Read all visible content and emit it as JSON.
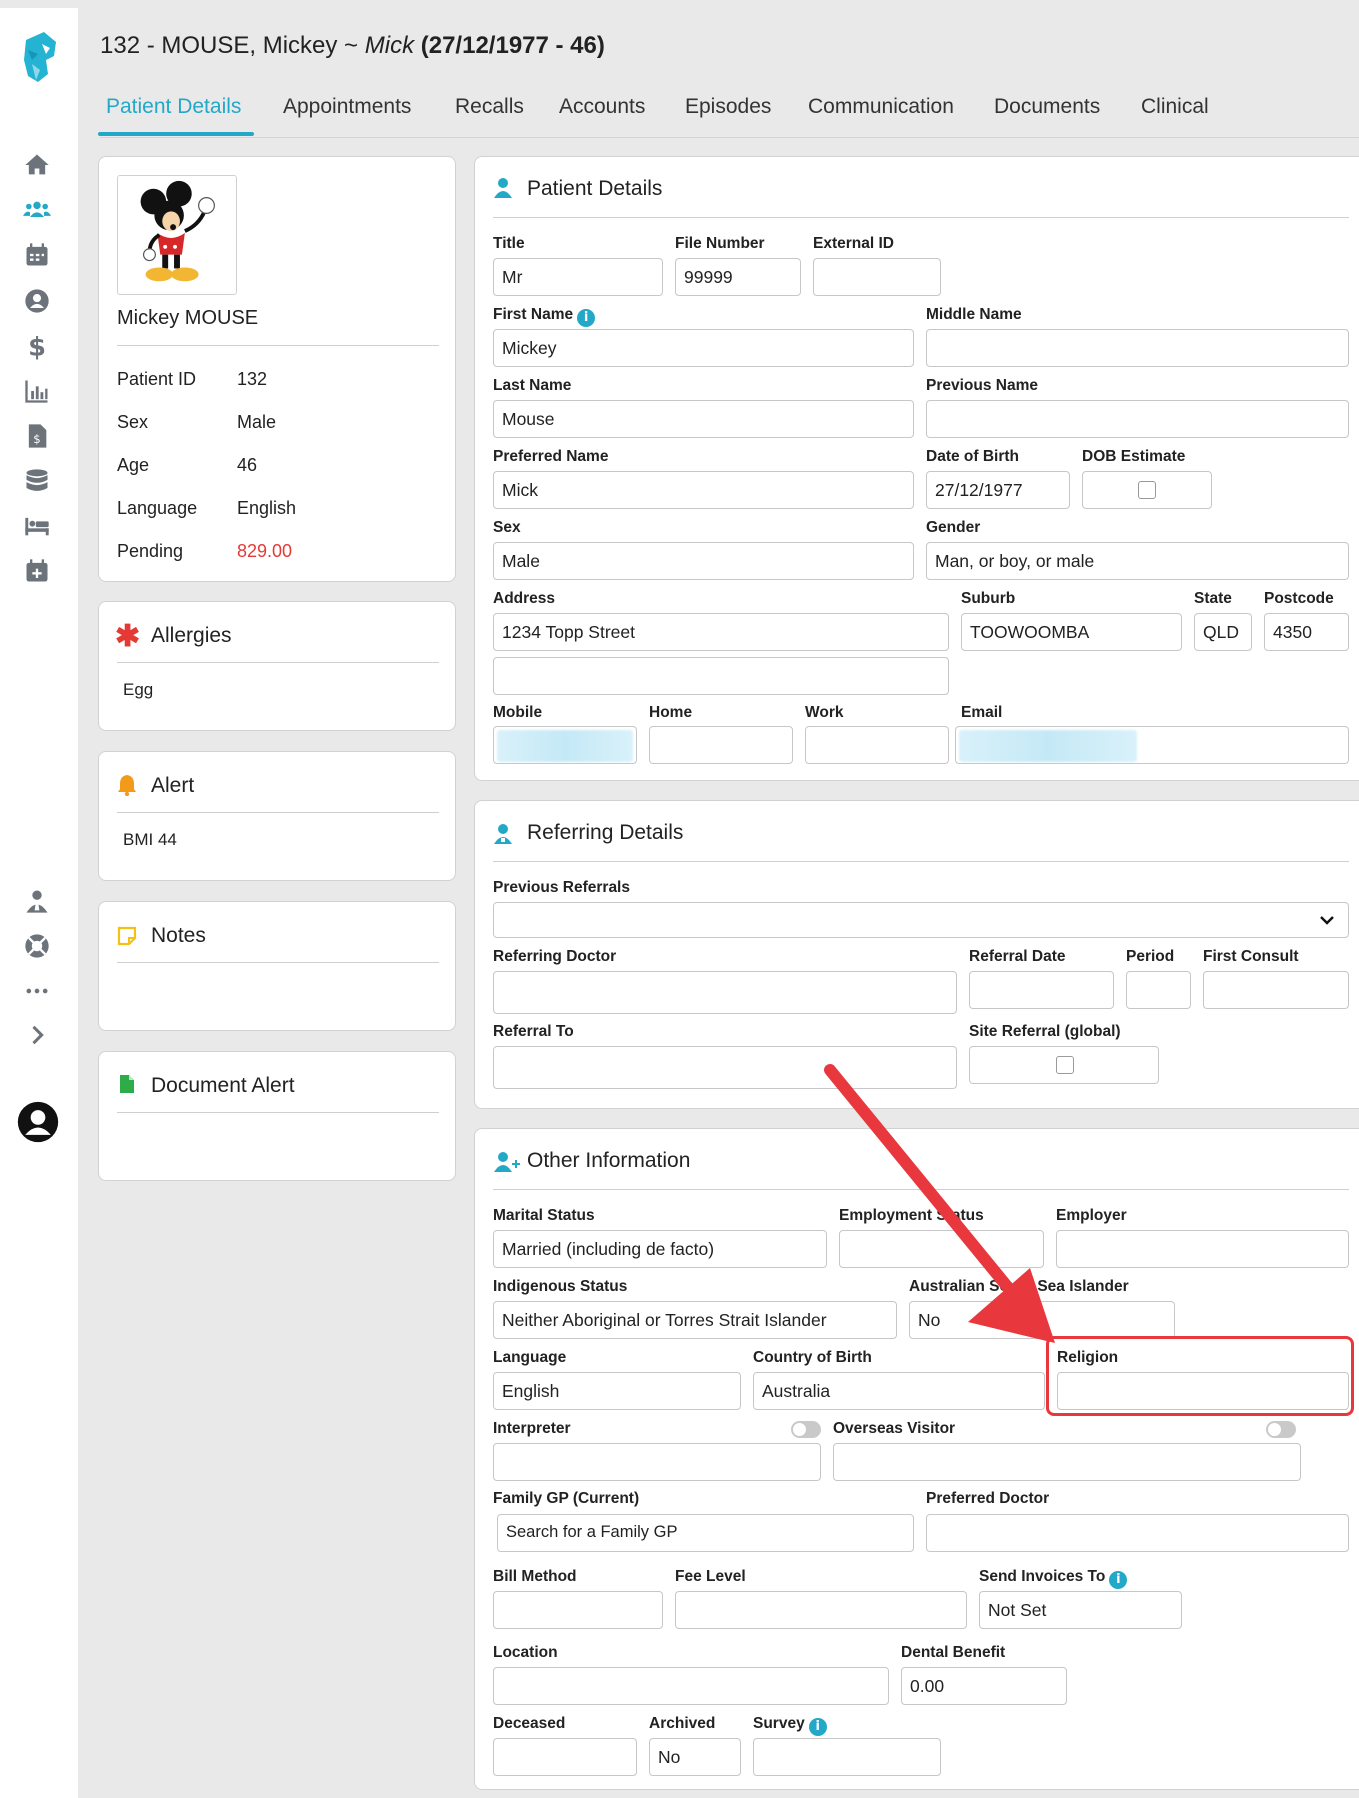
{
  "header": {
    "id_name": "132 - MOUSE, Mickey ~ ",
    "preferred": "Mick",
    "dob_age": " (27/12/1977 - 46)"
  },
  "tabs": [
    "Patient Details",
    "Appointments",
    "Recalls",
    "Accounts",
    "Episodes",
    "Communication",
    "Documents",
    "Clinical"
  ],
  "rail_icons": [
    "home-icon",
    "patients-icon",
    "calendar-icon",
    "user-circle-icon",
    "dollar-icon",
    "bar-chart-icon",
    "invoice-icon",
    "database-icon",
    "bed-icon",
    "calendar-plus-icon",
    "admin-icon",
    "support-icon",
    "more-icon",
    "chevron-right-icon",
    "account-icon"
  ],
  "summary": {
    "name": "Mickey MOUSE",
    "rows": [
      {
        "label": "Patient ID",
        "value": "132"
      },
      {
        "label": "Sex",
        "value": "Male"
      },
      {
        "label": "Age",
        "value": "46"
      },
      {
        "label": "Language",
        "value": "English"
      },
      {
        "label": "Pending",
        "value": "829.00"
      }
    ]
  },
  "allergies": {
    "title": "Allergies",
    "text": "Egg"
  },
  "alert": {
    "title": "Alert",
    "text": "BMI 44"
  },
  "notes": {
    "title": "Notes"
  },
  "document_alert": {
    "title": "Document Alert"
  },
  "patient_details": {
    "title": "Patient Details",
    "labels": {
      "title": "Title",
      "file_number": "File Number",
      "external_id": "External ID",
      "first_name": "First Name",
      "middle_name": "Middle Name",
      "last_name": "Last Name",
      "previous_name": "Previous Name",
      "preferred_name": "Preferred Name",
      "dob": "Date of Birth",
      "dob_estimate": "DOB Estimate",
      "sex": "Sex",
      "gender": "Gender",
      "address": "Address",
      "suburb": "Suburb",
      "state": "State",
      "postcode": "Postcode",
      "mobile": "Mobile",
      "home": "Home",
      "work": "Work",
      "email": "Email"
    },
    "values": {
      "title": "Mr",
      "file_number": "99999",
      "external_id": "",
      "first_name": "Mickey",
      "middle_name": "",
      "last_name": "Mouse",
      "previous_name": "",
      "preferred_name": "Mick",
      "dob": "27/12/1977",
      "sex": "Male",
      "gender": "Man, or boy, or male",
      "address1": "1234 Topp Street",
      "address2": "",
      "suburb": "TOOWOOMBA",
      "state": "QLD",
      "postcode": "4350"
    }
  },
  "referring": {
    "title": "Referring Details",
    "labels": {
      "previous_referrals": "Previous Referrals",
      "referring_doctor": "Referring Doctor",
      "referral_date": "Referral Date",
      "period": "Period",
      "first_consult": "First Consult",
      "referral_to": "Referral To",
      "site_referral": "Site Referral (global)"
    }
  },
  "other": {
    "title": "Other Information",
    "labels": {
      "marital_status": "Marital Status",
      "employment_status": "Employment Status",
      "employer": "Employer",
      "indigenous_status": "Indigenous Status",
      "south_sea": "Australian South Sea Islander",
      "language": "Language",
      "country_of_birth": "Country of Birth",
      "religion": "Religion",
      "interpreter": "Interpreter",
      "overseas_visitor": "Overseas Visitor",
      "family_gp": "Family GP (Current)",
      "preferred_doctor": "Preferred Doctor",
      "bill_method": "Bill Method",
      "fee_level": "Fee Level",
      "send_invoices_to": "Send Invoices To",
      "location": "Location",
      "dental_benefit": "Dental Benefit",
      "deceased": "Deceased",
      "archived": "Archived",
      "survey": "Survey"
    },
    "values": {
      "marital_status": "Married (including de facto)",
      "indigenous_status": "Neither Aboriginal or Torres Strait Islander",
      "south_sea": "No",
      "language": "English",
      "country_of_birth": "Australia",
      "religion": "",
      "family_gp_placeholder": "Search for a Family GP",
      "send_invoices_to": "Not Set",
      "dental_benefit": "0.00",
      "archived": "No"
    }
  },
  "colors": {
    "accent": "#23a8c8",
    "pending": "#e53935",
    "annotation": "#e8383e"
  }
}
